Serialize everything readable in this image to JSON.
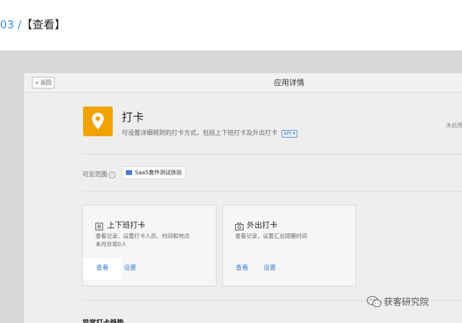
{
  "heading": {
    "number": "03 /",
    "title": "【查看】"
  },
  "topbar": {
    "back_label": "« 返回",
    "page_title": "应用详情"
  },
  "app": {
    "icon": "location-pin-icon",
    "icon_color": "#f0a300",
    "name": "打卡",
    "description": "可设置详细规则的打卡方式，包括上下班打卡及外出打卡",
    "api_tag": "API ▾",
    "status": "未启用"
  },
  "scope": {
    "label": "可见范围",
    "tag": "SaaS套件测试体验"
  },
  "cards": [
    {
      "title": "上下班打卡",
      "icon": "list-icon",
      "desc_line1": "查看记录，设置打卡人员、时间和地点",
      "desc_line2": "本月异常0人",
      "view_label": "查看",
      "settings_label": "设置"
    },
    {
      "title": "外出打卡",
      "icon": "camera-icon",
      "desc_line1": "查看记录，设置汇总提醒时间",
      "desc_line2": "",
      "view_label": "查看",
      "settings_label": "设置"
    }
  ],
  "section": {
    "trend_title": "异常打卡趋势"
  },
  "watermark": {
    "text": "获客研究院",
    "icon": "wechat-icon"
  },
  "colors": {
    "link": "#3a7bd5",
    "heading_number": "#3a8ee6"
  }
}
